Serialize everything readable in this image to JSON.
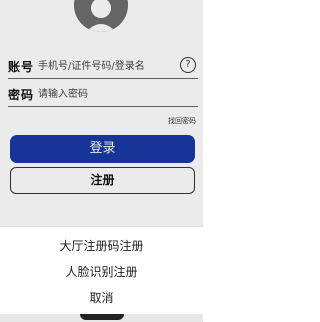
{
  "login_form": {
    "account_label": "账号",
    "account_placeholder": "手机号/证件号码/登录名",
    "help_icon_glyph": "?",
    "password_label": "密码",
    "password_placeholder": "请输入密码",
    "forgot_password_label": "找回密码",
    "login_button_label": "登录",
    "register_button_label": "注册",
    "login_button_color": "#1a3aa5"
  },
  "action_sheet": {
    "items": [
      {
        "label": "大厅注册码注册"
      },
      {
        "label": "人脸识别注册"
      },
      {
        "label": "取消"
      }
    ]
  },
  "icons": {
    "avatar": "user-avatar-icon",
    "help": "help-circle-icon"
  }
}
